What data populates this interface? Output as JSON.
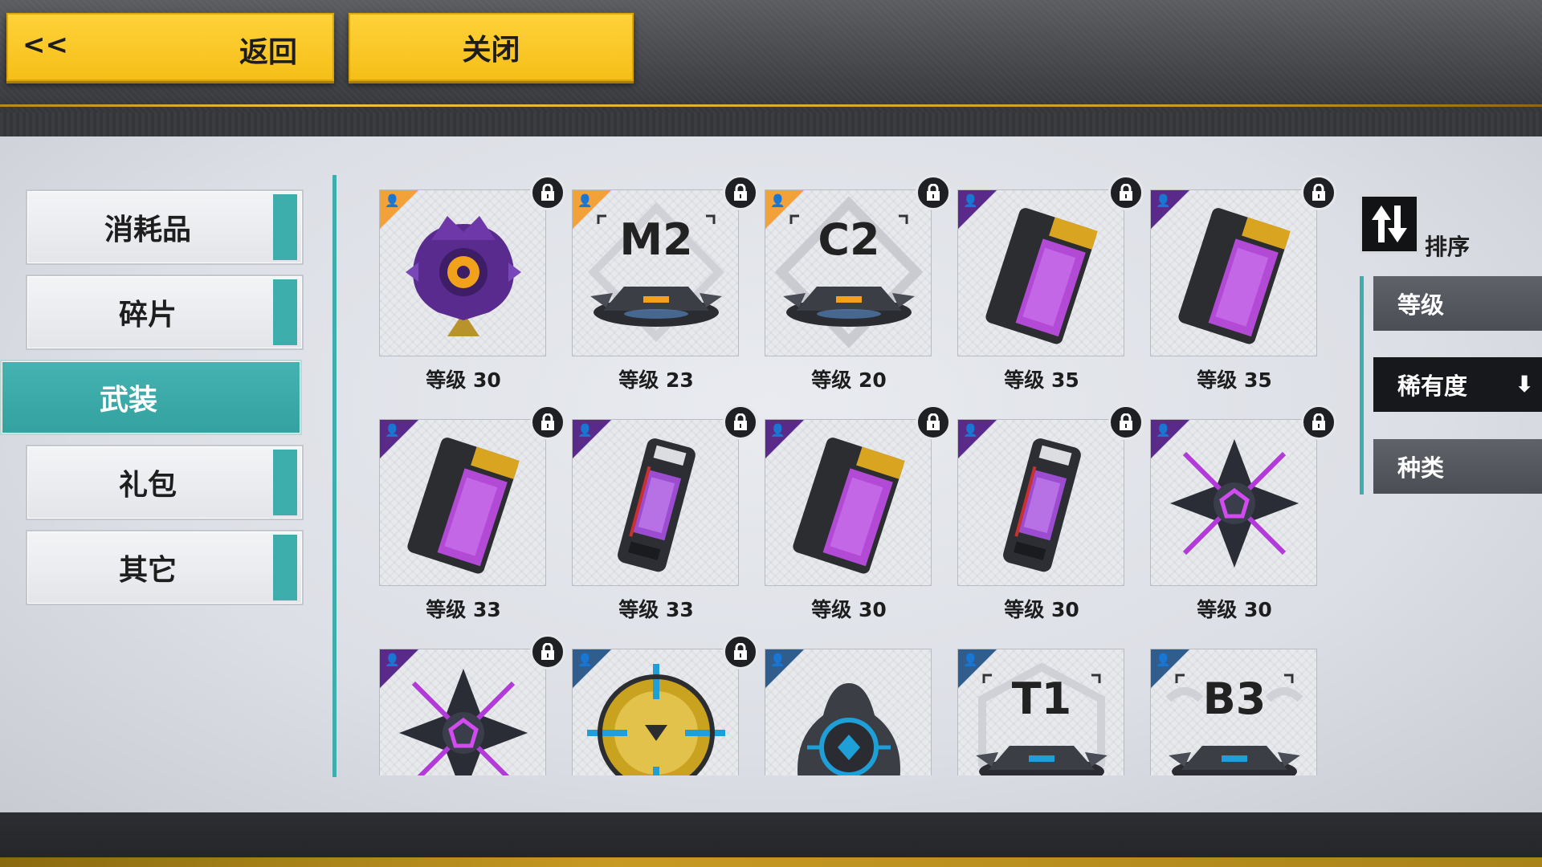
{
  "header": {
    "back_arrows": "<<",
    "back_label": "返回",
    "close_label": "关闭"
  },
  "categories": [
    {
      "label": "消耗品",
      "active": false
    },
    {
      "label": "碎片",
      "active": false
    },
    {
      "label": "武装",
      "active": true
    },
    {
      "label": "礼包",
      "active": false
    },
    {
      "label": "其它",
      "active": false
    }
  ],
  "items": [
    {
      "art": "purple-drone",
      "rarity": "orange",
      "locked": true,
      "level": "等级 30"
    },
    {
      "art": "m2-tank",
      "code": "M2",
      "rarity": "orange",
      "locked": true,
      "level": "等级 23"
    },
    {
      "art": "c2-tank",
      "code": "C2",
      "rarity": "orange",
      "locked": true,
      "level": "等级 20"
    },
    {
      "art": "memory-card",
      "rarity": "purple",
      "locked": true,
      "level": "等级 35"
    },
    {
      "art": "memory-card",
      "rarity": "purple",
      "locked": true,
      "level": "等级 35"
    },
    {
      "art": "memory-card",
      "rarity": "purple",
      "locked": true,
      "level": "等级 33"
    },
    {
      "art": "battery-module",
      "rarity": "purple",
      "locked": true,
      "level": "等级 33"
    },
    {
      "art": "memory-card",
      "rarity": "purple",
      "locked": true,
      "level": "等级 30"
    },
    {
      "art": "battery-module",
      "rarity": "purple",
      "locked": true,
      "level": "等级 30"
    },
    {
      "art": "star-core",
      "rarity": "purple",
      "locked": true,
      "level": "等级 30"
    },
    {
      "art": "star-core",
      "rarity": "purple",
      "locked": true,
      "level": ""
    },
    {
      "art": "gold-orb",
      "rarity": "blue",
      "locked": true,
      "level": ""
    },
    {
      "art": "blue-core",
      "rarity": "blue",
      "locked": false,
      "level": ""
    },
    {
      "art": "t1-tank",
      "code": "T1",
      "rarity": "blue",
      "locked": false,
      "level": ""
    },
    {
      "art": "b3-tank",
      "code": "B3",
      "rarity": "blue",
      "locked": false,
      "level": ""
    }
  ],
  "sort": {
    "title": "排序",
    "toggle_icon": "sort-toggle-icon",
    "options": [
      {
        "label": "等级",
        "active": false
      },
      {
        "label": "稀有度",
        "active": true,
        "direction": "descending"
      },
      {
        "label": "种类",
        "active": false
      }
    ]
  },
  "colors": {
    "accent_teal": "#3eaeac",
    "button_yellow": "#f5bf18",
    "rarity_orange": "#f3a23a",
    "rarity_purple": "#5a2a8a",
    "rarity_blue": "#2e5d8e"
  }
}
